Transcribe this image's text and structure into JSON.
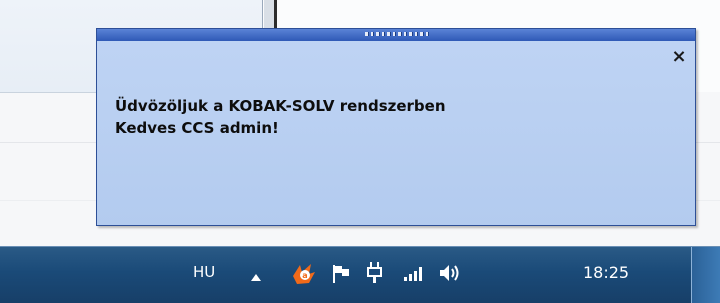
{
  "notification": {
    "line1": "Üdvözöljuk a KOBAK-SOLV rendszerben",
    "line2": "Kedves CCS admin!",
    "close_glyph": "×"
  },
  "taskbar": {
    "language": "HU",
    "clock": "18:25",
    "tray_icons": [
      "show-hidden-icons-arrow-icon",
      "avast-antivirus-icon",
      "action-center-flag-icon",
      "power-plug-icon",
      "network-signal-icon",
      "volume-icon"
    ]
  },
  "colors": {
    "popup_bg": "#b8cff1",
    "popup_titlebar": "#3a63c0",
    "taskbar": "#1d4c7c",
    "avast_orange": "#f06a1a"
  }
}
